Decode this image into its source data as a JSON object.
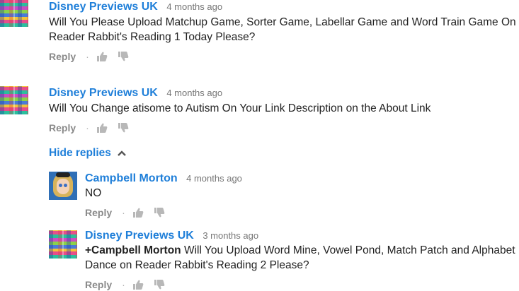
{
  "comments": [
    {
      "author": "Disney Previews UK",
      "time": "4 months ago",
      "text": "Will You Please Upload Matchup Game, Sorter Game, Labellar Game and Word Train Game On Reader Rabbit's Reading 1 Today Please?",
      "reply_label": "Reply"
    },
    {
      "author": "Disney Previews UK",
      "time": "4 months ago",
      "text": "Will You Change atisome to Autism On Your Link Description on the About Link",
      "reply_label": "Reply"
    }
  ],
  "replies_toggle": {
    "label": "Hide replies"
  },
  "replies": [
    {
      "author": "Campbell Morton",
      "time": "4 months ago",
      "text": "NO",
      "reply_label": "Reply"
    },
    {
      "author": "Disney Previews UK",
      "time": "3 months ago",
      "mention": "+Campbell Morton",
      "text": " Will You Upload Word Mine, Vowel Pond, Match Patch and Alphabet Dance on Reader Rabbit's Reading 2 Please?",
      "reply_label": "Reply"
    }
  ],
  "icons": {
    "like": "thumbs-up-icon",
    "dislike": "thumbs-down-icon",
    "collapse": "chevron-up-icon"
  },
  "colors": {
    "link_blue": "#1f7fd9",
    "muted_gray": "#767676",
    "text": "#222222"
  }
}
